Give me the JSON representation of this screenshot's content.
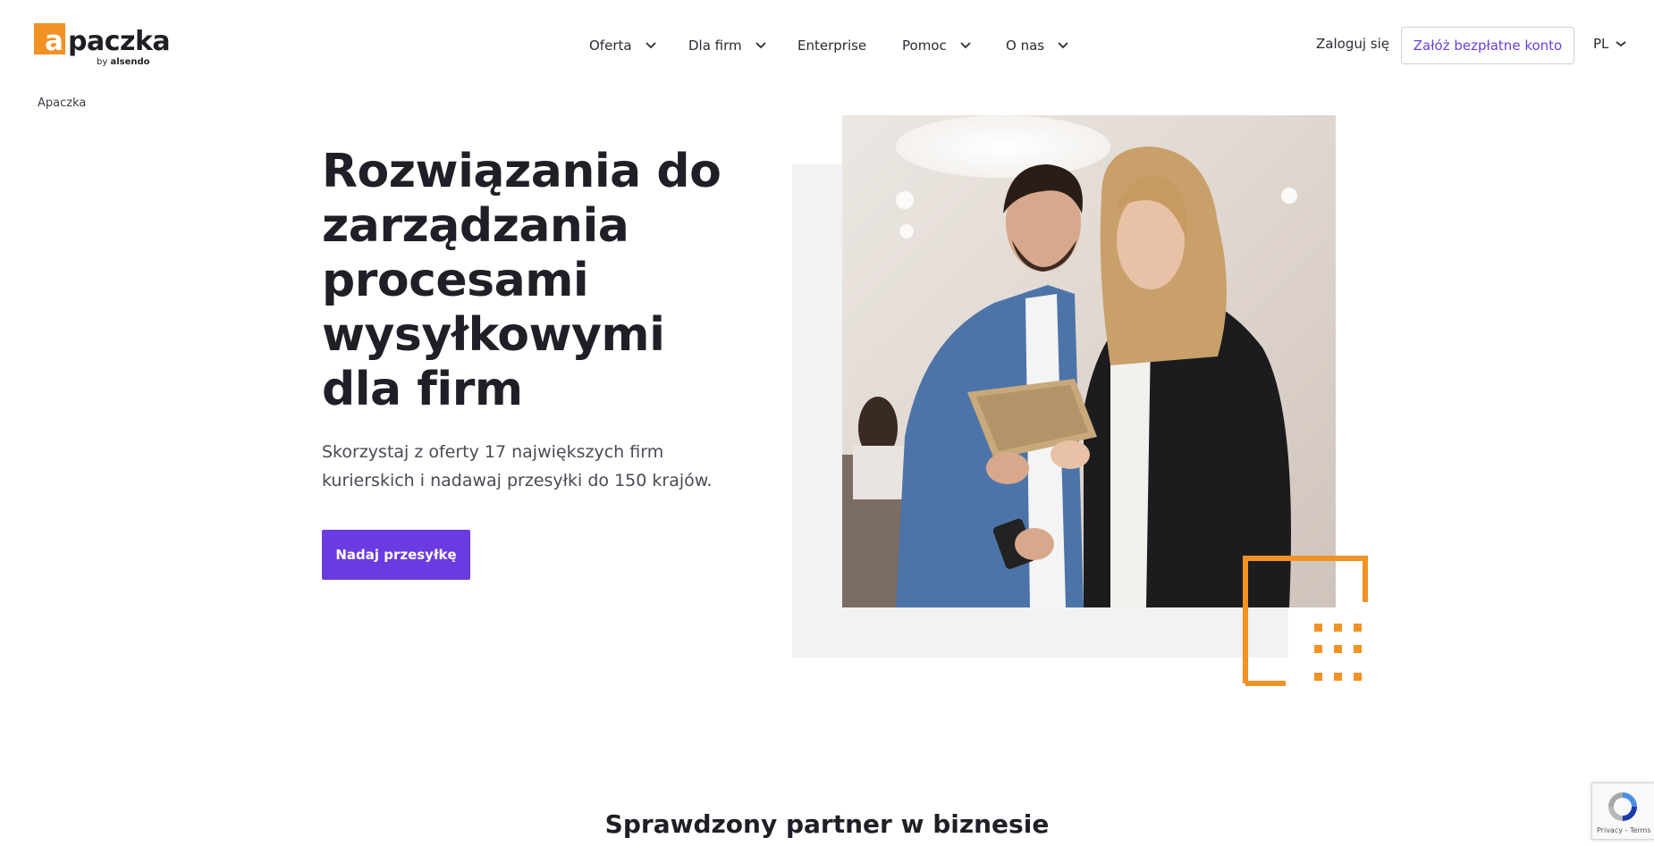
{
  "brand": {
    "logo_letter": "a",
    "logo_text": "paczka",
    "by_prefix": "by ",
    "by_company": "alsendo"
  },
  "nav": {
    "items": [
      {
        "label": "Oferta",
        "has_dropdown": true
      },
      {
        "label": "Dla firm",
        "has_dropdown": true
      },
      {
        "label": "Enterprise",
        "has_dropdown": false
      },
      {
        "label": "Pomoc",
        "has_dropdown": true
      },
      {
        "label": "O nas",
        "has_dropdown": true
      }
    ],
    "login_label": "Zaloguj się",
    "signup_label": "Załóż bezpłatne konto",
    "language": "PL"
  },
  "breadcrumb": "Apaczka",
  "hero": {
    "title": "Rozwiązania do zarządzania procesami wysyłkowymi dla firm",
    "subtitle": "Skorzystaj z oferty 17 największych firm kurierskich i nadawaj przesyłki do 150 krajów.",
    "cta_label": "Nadaj przesyłkę"
  },
  "section": {
    "title": "Sprawdzony partner w biznesie"
  },
  "recaptcha": {
    "text": "Privacy - Terms"
  },
  "colors": {
    "accent": "#6a3be0",
    "brand_orange": "#f29124",
    "text": "#1f1f27"
  }
}
